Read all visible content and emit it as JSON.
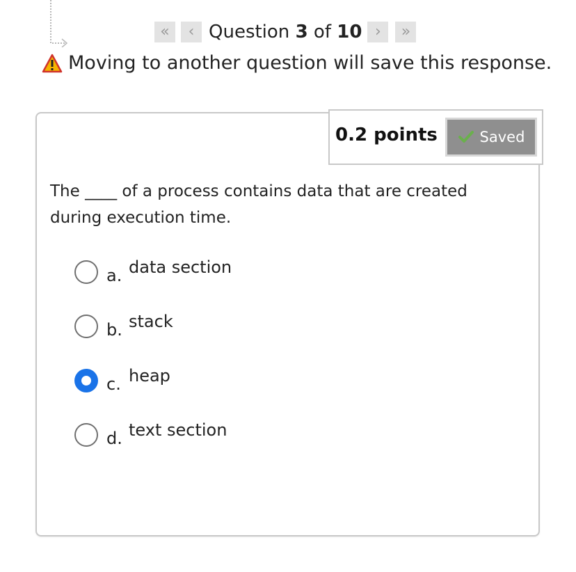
{
  "nav": {
    "first_icon": "double-chevron-left-icon",
    "prev_icon": "chevron-left-icon",
    "next_icon": "chevron-right-icon",
    "last_icon": "double-chevron-right-icon",
    "question_prefix": "Question ",
    "current": "3",
    "of_label": " of ",
    "total": "10"
  },
  "warning": {
    "icon": "warning-icon",
    "text": "Moving to another question will save this response."
  },
  "card": {
    "points": "0.2 points",
    "saved_label": "Saved",
    "saved_icon": "checkmark-icon",
    "question_text": "The ____ of a process contains data that are created during execution time.",
    "options": [
      {
        "letter": "a.",
        "text": "data section",
        "selected": false
      },
      {
        "letter": "b.",
        "text": "stack",
        "selected": false
      },
      {
        "letter": "c.",
        "text": "heap",
        "selected": true
      },
      {
        "letter": "d.",
        "text": "text section",
        "selected": false
      }
    ]
  },
  "colors": {
    "accent": "#1a73e8",
    "saved_bg": "#8f8f8f",
    "warning_yellow": "#f5b400",
    "warning_red": "#d0342c",
    "check_green": "#6ab04c"
  }
}
